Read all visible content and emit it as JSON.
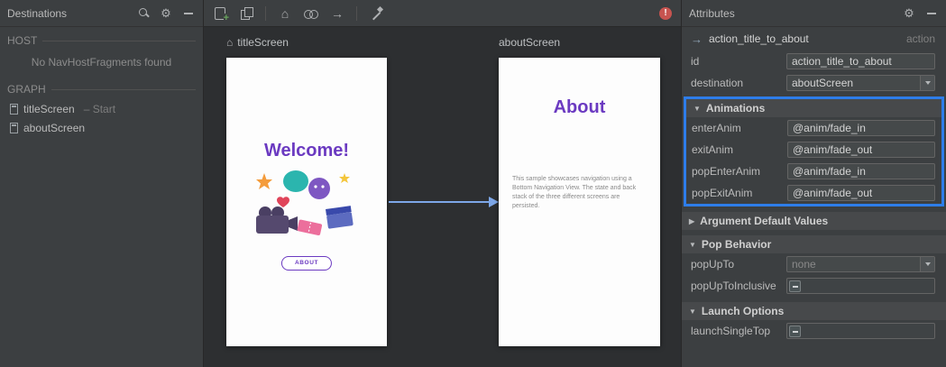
{
  "destinations": {
    "title": "Destinations",
    "host_section": "HOST",
    "host_empty": "No NavHostFragments found",
    "graph_section": "GRAPH",
    "items": [
      {
        "label": "titleScreen",
        "suffix": "– Start"
      },
      {
        "label": "aboutScreen",
        "suffix": ""
      }
    ]
  },
  "canvas": {
    "title_screen": {
      "label": "titleScreen",
      "heading": "Welcome!",
      "button_label": "ABOUT"
    },
    "about_screen": {
      "label": "aboutScreen",
      "heading": "About",
      "body": "This sample showcases navigation using a Bottom Navigation View. The state and back stack of the three different screens are persisted."
    }
  },
  "toolbar": {
    "error_badge": "!"
  },
  "attributes": {
    "title": "Attributes",
    "action_name": "action_title_to_about",
    "action_kind": "action",
    "id_label": "id",
    "id_value": "action_title_to_about",
    "destination_label": "destination",
    "destination_value": "aboutScreen",
    "animations": {
      "header": "Animations",
      "rows": [
        {
          "label": "enterAnim",
          "value": "@anim/fade_in"
        },
        {
          "label": "exitAnim",
          "value": "@anim/fade_out"
        },
        {
          "label": "popEnterAnim",
          "value": "@anim/fade_in"
        },
        {
          "label": "popExitAnim",
          "value": "@anim/fade_out"
        }
      ]
    },
    "argument_defaults_header": "Argument Default Values",
    "pop_behavior": {
      "header": "Pop Behavior",
      "popupto_label": "popUpTo",
      "popupto_value": "none",
      "popuptoinclusive_label": "popUpToInclusive"
    },
    "launch_options": {
      "header": "Launch Options",
      "launchsingletop_label": "launchSingleTop"
    }
  },
  "colors": {
    "selection_blue": "#2e7de9",
    "arrow_blue": "#7da7e8",
    "brand_purple": "#6b3ac1",
    "error_red": "#c75450"
  }
}
